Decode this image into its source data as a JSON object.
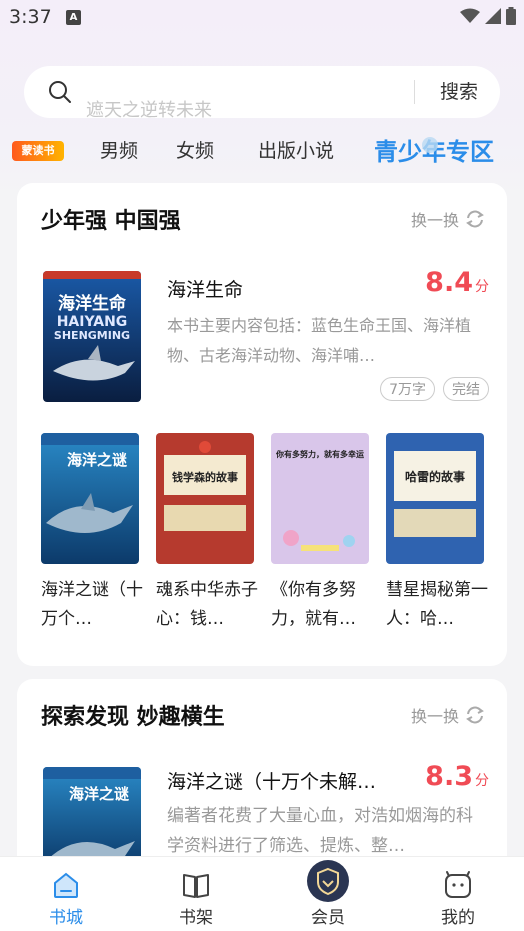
{
  "status": {
    "time": "3:37",
    "a_badge": "A"
  },
  "search": {
    "hint": "遮天之逆转未来",
    "button": "搜索"
  },
  "tabs": {
    "logo": "蒙读书",
    "items": [
      "男频",
      "女频",
      "出版小说",
      "青少年专区"
    ],
    "active_index": 3
  },
  "card1": {
    "title": "少年强 中国强",
    "refresh": "换一换",
    "featured": {
      "title": "海洋生命",
      "score": "8.4",
      "score_unit": "分",
      "desc": "本书主要内容包括：蓝色生命王国、海洋植物、古老海洋动物、海洋哺…",
      "tags": [
        "7万字",
        "完结"
      ],
      "cover_text": "海洋生命",
      "cover_sub1": "HAIYANG",
      "cover_sub2": "SHENGMING"
    },
    "grid": [
      {
        "title": "海洋之谜（十万个…",
        "cover_text": "海洋之谜"
      },
      {
        "title": "魂系中华赤子心：钱…",
        "cover_text": "钱学森的故事"
      },
      {
        "title": "《你有多努力，就有…",
        "cover_text": "你有多努力，就有多幸运"
      },
      {
        "title": "彗星揭秘第一人：哈…",
        "cover_text": "哈雷的故事"
      }
    ]
  },
  "card2": {
    "title": "探索发现 妙趣横生",
    "refresh": "换一换",
    "item": {
      "title": "海洋之谜（十万个未解…",
      "score": "8.3",
      "score_unit": "分",
      "desc": "编著者花费了大量心血，对浩如烟海的科学资料进行了筛选、提炼、整…",
      "cover_text": "海洋之谜"
    }
  },
  "nav": {
    "items": [
      "书城",
      "书架",
      "会员",
      "我的"
    ],
    "active_index": 0
  },
  "colors": {
    "accent": "#2b8de9",
    "score": "#f04b55"
  }
}
